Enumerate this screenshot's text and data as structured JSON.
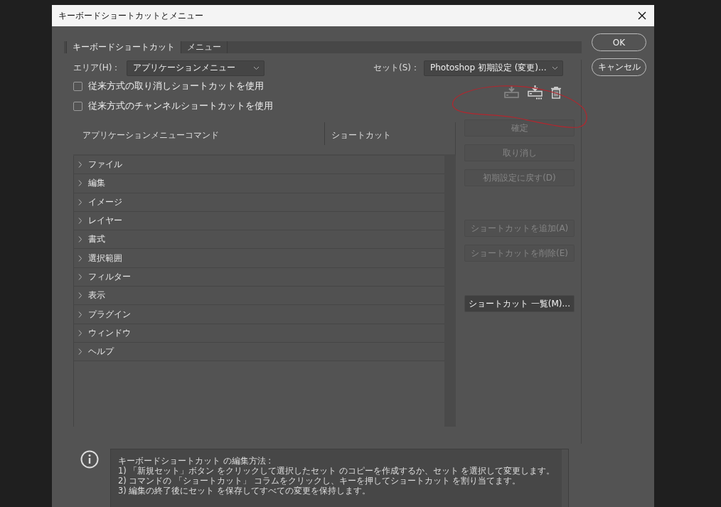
{
  "window": {
    "title": "キーボードショートカットとメニュー"
  },
  "tabs": [
    {
      "label": "キーボードショートカット",
      "selected": true
    },
    {
      "label": "メニュー",
      "selected": false
    }
  ],
  "area": {
    "label": "エリア(H)：",
    "value": "アプリケーションメニュー"
  },
  "set": {
    "label": "セット(S)：",
    "value": "Photoshop 初期設定 (変更)..."
  },
  "checkboxes": [
    {
      "label": "従来方式の取り消しショートカットを使用",
      "checked": false
    },
    {
      "label": "従来方式のチャンネルショートカットを使用",
      "checked": false
    }
  ],
  "toolbar": [
    {
      "kind": "save",
      "disabled": true
    },
    {
      "kind": "save-as",
      "disabled": false
    },
    {
      "kind": "delete",
      "disabled": false
    }
  ],
  "table": {
    "columns": [
      "アプリケーションメニューコマンド",
      "ショートカット"
    ],
    "rows": [
      {
        "label": "ファイル",
        "expanded": false
      },
      {
        "label": "編集",
        "expanded": false
      },
      {
        "label": "イメージ",
        "expanded": false
      },
      {
        "label": "レイヤー",
        "expanded": false
      },
      {
        "label": "書式",
        "expanded": false
      },
      {
        "label": "選択範囲",
        "expanded": false
      },
      {
        "label": "フィルター",
        "expanded": false
      },
      {
        "label": "表示",
        "expanded": false
      },
      {
        "label": "プラグイン",
        "expanded": false
      },
      {
        "label": "ウィンドウ",
        "expanded": false
      },
      {
        "label": "ヘルプ",
        "expanded": false
      }
    ]
  },
  "side_buttons": [
    {
      "label": "確定",
      "disabled": true
    },
    {
      "label": "取り消し",
      "disabled": true
    },
    {
      "label": "初期設定に戻す(D)",
      "disabled": true
    },
    {
      "label": "ショートカットを追加(A)",
      "disabled": true
    },
    {
      "label": "ショートカットを削除(E)",
      "disabled": true
    },
    {
      "label": "ショートカット 一覧(M)...",
      "disabled": false
    }
  ],
  "dialog_buttons": [
    "OK",
    "キャンセル"
  ],
  "info": {
    "title": "キーボードショートカット の編集方法 :",
    "lines": [
      "1) 「新規セット」ボタン をクリックして選択したセット のコピーを作成するか、セット を選択して変更します。",
      "2) コマンドの 「ショートカット」 コラムをクリックし、キーを押してショートカット を割り当てます。",
      "3) 編集の終了後にセット を保存してすべての変更を保持します。"
    ]
  }
}
